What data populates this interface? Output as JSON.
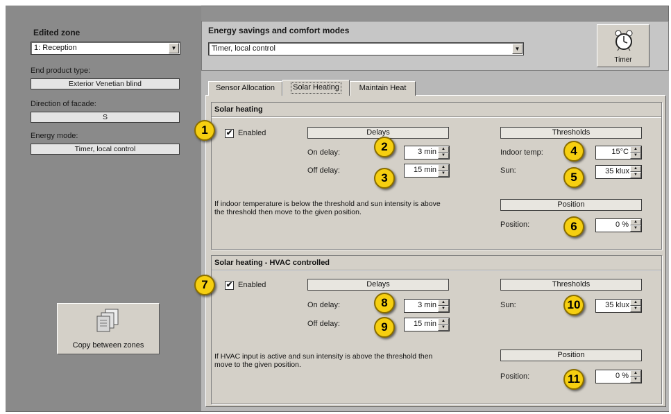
{
  "left": {
    "edited_zone_label": "Edited zone",
    "edited_zone_value": "1: Reception",
    "end_product_label": "End product type:",
    "end_product_value": "Exterior Venetian blind",
    "facade_label": "Direction of facade:",
    "facade_value": "S",
    "energy_mode_label": "Energy mode:",
    "energy_mode_value": "Timer, local control",
    "copy_button_label": "Copy between zones"
  },
  "top": {
    "modes_label": "Energy savings and comfort modes",
    "modes_value": "Timer, local control",
    "timer_button_label": "Timer"
  },
  "tabs": [
    "Sensor Allocation",
    "Solar Heating",
    "Maintain Heat"
  ],
  "solar": {
    "title": "Solar heating",
    "enabled_label": "Enabled",
    "delays_header": "Delays",
    "on_delay_label": "On delay:",
    "on_delay_value": "3 min",
    "off_delay_label": "Off delay:",
    "off_delay_value": "15 min",
    "thresholds_header": "Thresholds",
    "indoor_temp_label": "Indoor temp:",
    "indoor_temp_value": "15°C",
    "sun_label": "Sun:",
    "sun_value": "35 klux",
    "position_header": "Position",
    "position_label": "Position:",
    "position_value": "0 %",
    "description": "If indoor temperature is below the threshold and sun intensity is above the threshold then move to the given position."
  },
  "hvac": {
    "title": "Solar heating - HVAC controlled",
    "enabled_label": "Enabled",
    "delays_header": "Delays",
    "on_delay_label": "On delay:",
    "on_delay_value": "3 min",
    "off_delay_label": "Off delay:",
    "off_delay_value": "15 min",
    "thresholds_header": "Thresholds",
    "sun_label": "Sun:",
    "sun_value": "35 klux",
    "position_header": "Position",
    "position_label": "Position:",
    "position_value": "0 %",
    "description": "If HVAC input is active and sun intensity is above the threshold then move to the given position."
  },
  "callouts": [
    "1",
    "2",
    "3",
    "4",
    "5",
    "6",
    "7",
    "8",
    "9",
    "10",
    "11"
  ],
  "check_mark": "✔",
  "colors": {
    "callout": "#f6cf10",
    "panel": "#d4d0c8",
    "background": "#909090"
  }
}
